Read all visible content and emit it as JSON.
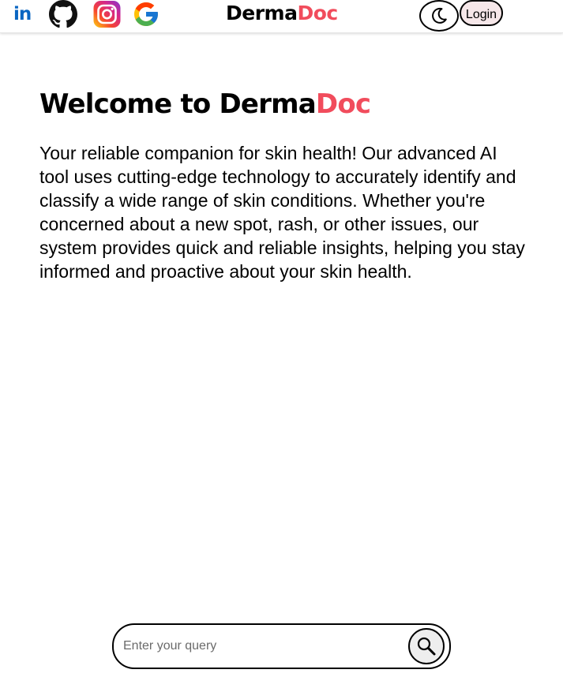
{
  "header": {
    "social": {
      "linkedin_text": "in",
      "linkedin_icon": "linkedin-icon",
      "github_icon": "github-icon",
      "instagram_icon": "instagram-icon",
      "google_icon": "google-icon"
    },
    "brand": {
      "part1": "Derma",
      "part2": "Doc"
    },
    "theme_toggle_icon": "moon-icon",
    "login_label": "Login"
  },
  "main": {
    "welcome": {
      "prefix": "Welcome to Derma",
      "accent": "Doc"
    },
    "intro": "Your reliable companion for skin health! Our advanced AI tool uses cutting-edge technology to accurately identify and classify a wide range of skin conditions. Whether you're concerned about a new spot, rash, or other issues, our system provides quick and reliable insights, helping you stay informed and proactive about your skin health."
  },
  "query": {
    "placeholder": "Enter your query",
    "value": "",
    "search_icon": "search-icon"
  },
  "colors": {
    "accent": "#f14c5c",
    "linkedin": "#0a66c2",
    "login_bg": "#f6e7e9"
  }
}
